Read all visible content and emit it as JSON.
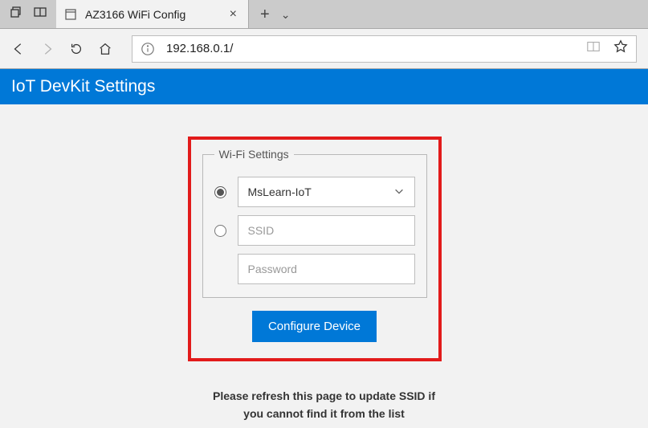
{
  "browser": {
    "tab_title": "AZ3166 WiFi Config",
    "url": "192.168.0.1/"
  },
  "page": {
    "header_title": "IoT DevKit Settings",
    "fieldset_legend": "Wi-Fi Settings",
    "ssid_selected": "MsLearn-IoT",
    "ssid_placeholder": "SSID",
    "password_placeholder": "Password",
    "configure_button": "Configure Device",
    "hint": "Please refresh this page to update SSID if you cannot find it from the list"
  }
}
